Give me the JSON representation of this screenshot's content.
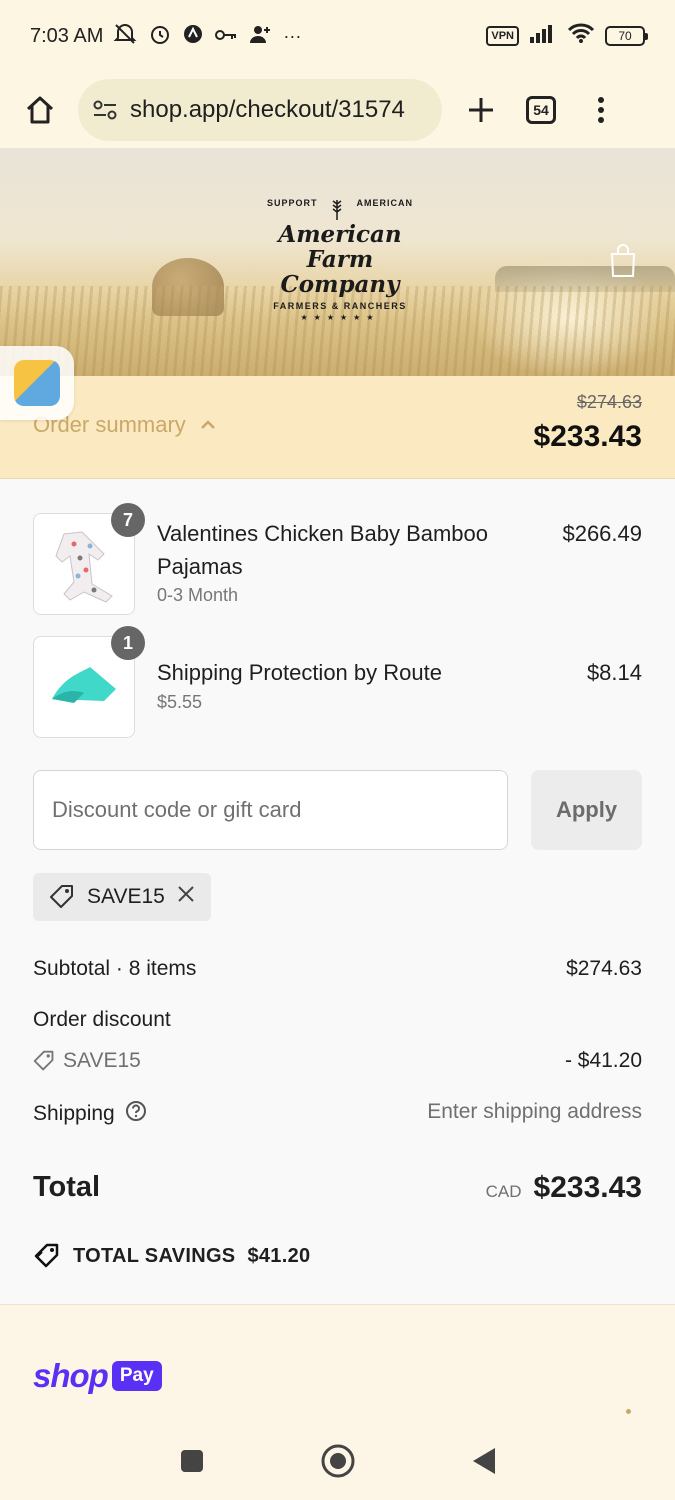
{
  "status_bar": {
    "time": "7:03 AM",
    "more": "···",
    "vpn": "VPN",
    "battery": "70"
  },
  "browser": {
    "url": "shop.app/checkout/31574",
    "tab_count": "54"
  },
  "order_summary": {
    "toggle_label": "Order summary",
    "original_total": "$274.63",
    "total": "$233.43"
  },
  "line_items": [
    {
      "name": "Valentines Chicken Baby Bamboo Pajamas",
      "variant": "0-3 Month",
      "price": "$266.49",
      "quantity": "7"
    },
    {
      "name": "Shipping Protection by Route",
      "variant": "$5.55",
      "price": "$8.14",
      "quantity": "1"
    }
  ],
  "discount": {
    "placeholder": "Discount code or gift card",
    "apply_label": "Apply",
    "applied_code": "SAVE15"
  },
  "totals": {
    "subtotal_label": "Subtotal · 8 items",
    "subtotal_value": "$274.63",
    "discount_label": "Order discount",
    "discount_code": "SAVE15",
    "discount_value": "- $41.20",
    "shipping_label": "Shipping",
    "shipping_value": "Enter shipping address",
    "total_label": "Total",
    "currency": "CAD",
    "total_value": "$233.43",
    "savings_label": "TOTAL SAVINGS",
    "savings_value": "$41.20"
  },
  "footer": {
    "shop_word": "shop",
    "pay_word": "Pay"
  },
  "brand": {
    "logo_top_left": "SUPPORT",
    "logo_top_right": "AMERICAN",
    "logo_line1": "American",
    "logo_line2": "Farm Company",
    "logo_sub": "FARMERS & RANCHERS",
    "logo_stars": "★★★★★★"
  },
  "colors": {
    "summary_bg": "#fbeac1",
    "summary_toggle": "#c9a86a",
    "shop_pay": "#5a31f4",
    "route_teal": "#40d8c8"
  }
}
